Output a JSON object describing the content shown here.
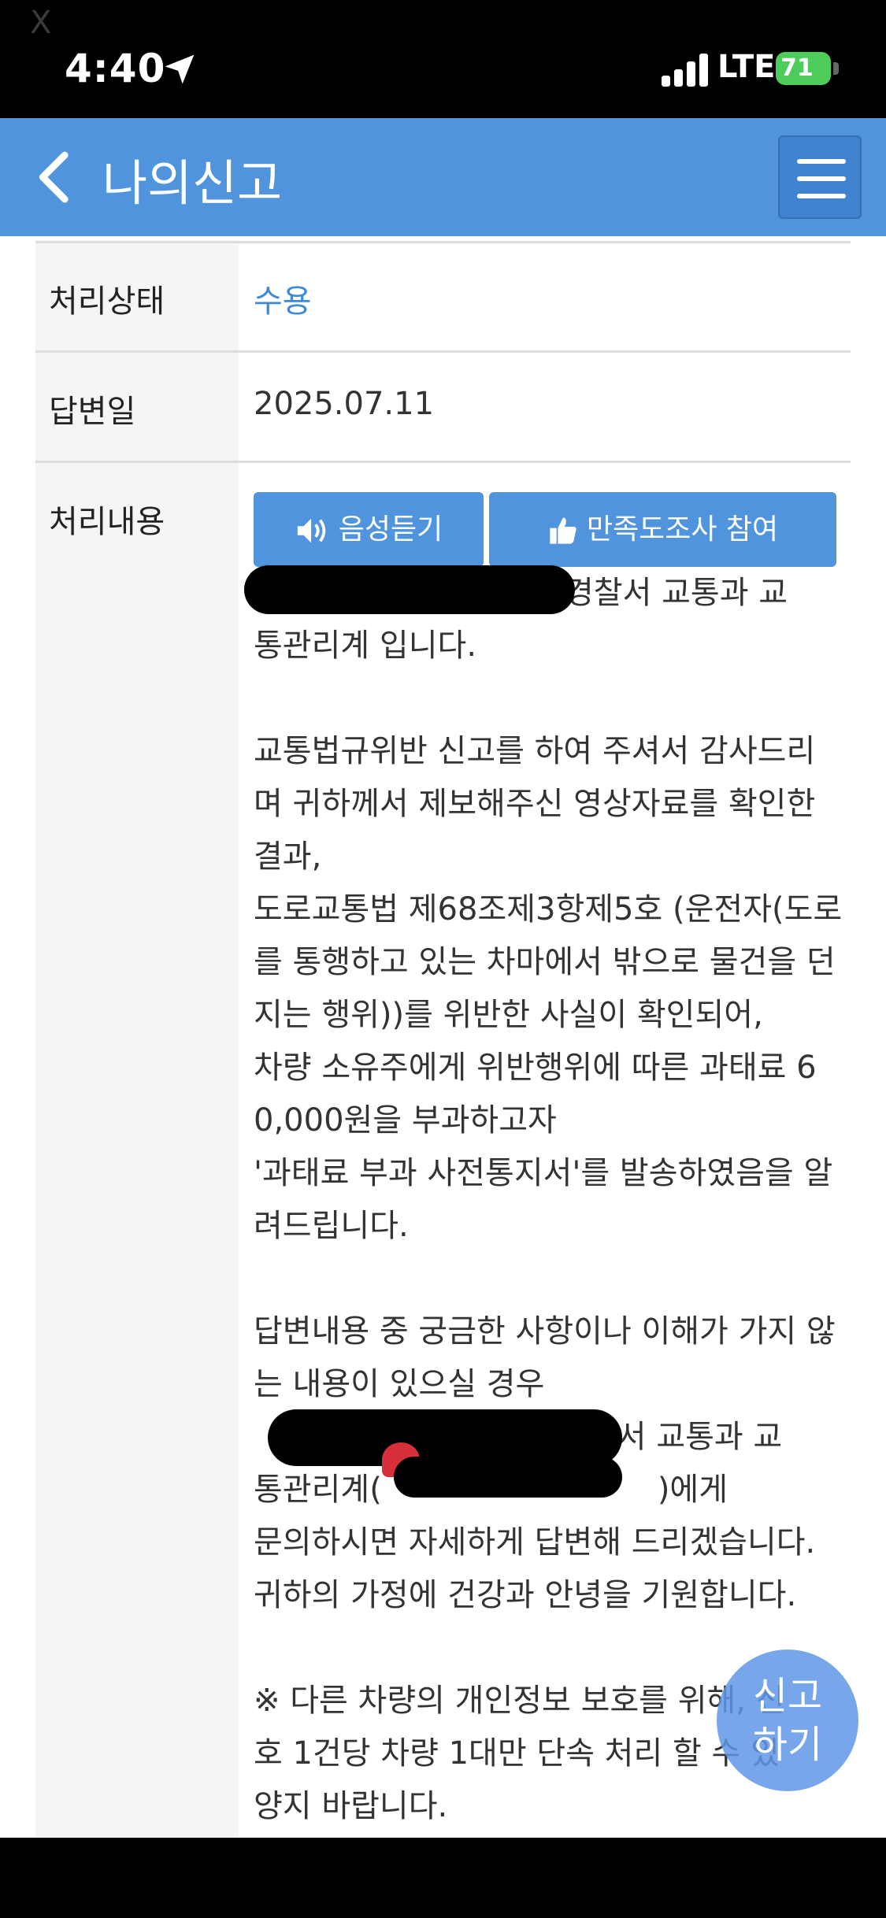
{
  "status_bar": {
    "corner_mark": "X",
    "time": "4:40",
    "network": "LTE",
    "battery": "71"
  },
  "header": {
    "title": "나의신고"
  },
  "rows": {
    "status_label": "처리상태",
    "status_value": "수용",
    "answer_date_label": "답변일",
    "answer_date_value": "2025.07.11",
    "content_label": "처리내용"
  },
  "buttons": {
    "voice": "음성듣기",
    "survey": "만족도조사 참여"
  },
  "content_lines": [
    "경찰서 교통과 교",
    "통관리계 입니다.",
    "",
    "교통법규위반 신고를 하여 주셔서 감사드리",
    "며 귀하께서 제보해주신 영상자료를 확인한",
    "결과,",
    "도로교통법 제68조제3항제5호 (운전자(도로",
    "를 통행하고 있는 차마에서 밖으로 물건을 던",
    "지는 행위))를 위반한 사실이 확인되어,",
    "차량 소유주에게 위반행위에 따른 과태료 6",
    "0,000원을 부과하고자",
    "'과태료 부과 사전통지서'를 발송하였음을 알",
    "려드립니다.",
    "",
    "답변내용 중 궁금한 사항이나 이해가 가지 않",
    "는 내용이 있으실 경우",
    "찰서 교통과 교",
    "통관리계(",
    "문의하시면 자세하게 답변해 드리겠습니다.",
    "귀하의 가정에 건강과 안녕을 기원합니다.",
    "",
    "※ 다른 차량의 개인정보 보호를 위해, 신",
    "호 1건당 차량 1대만 단속 처리 할 수 있",
    "양지 바랍니다."
  ],
  "content_suffix": ")에게",
  "fab": {
    "line1": "신고",
    "line2": "하기"
  },
  "colors": {
    "header": "#4f94dd",
    "status_value": "#3d8bd8"
  }
}
